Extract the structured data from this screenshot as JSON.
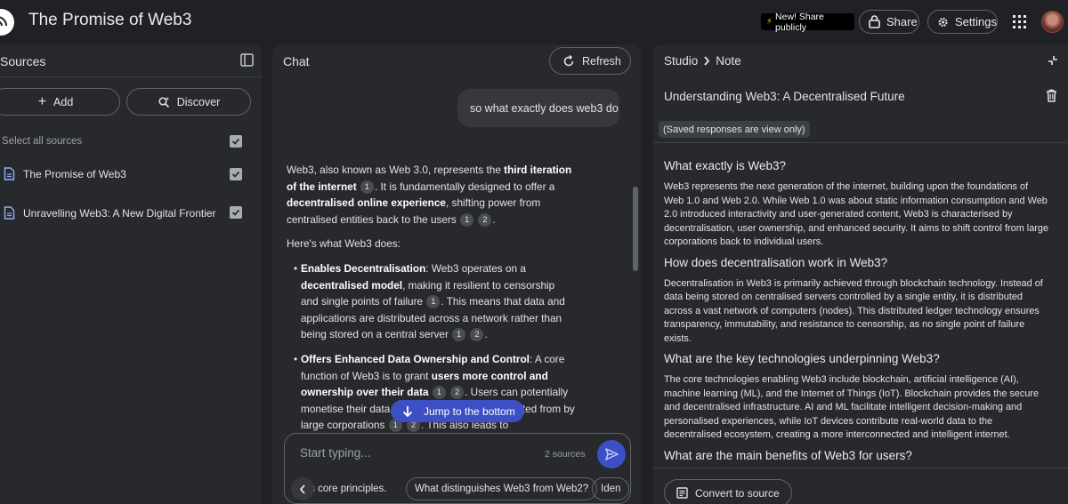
{
  "header": {
    "title": "The Promise of Web3",
    "share_publicly": "New! Share publicly",
    "share_label": "Share",
    "settings_label": "Settings"
  },
  "sources": {
    "title": "Sources",
    "add_label": "Add",
    "discover_label": "Discover",
    "select_all_label": "Select all sources",
    "items": [
      {
        "label": "The Promise of Web3",
        "checked": true
      },
      {
        "label": "Unravelling Web3: A New Digital Frontier",
        "checked": true
      }
    ]
  },
  "chat": {
    "title": "Chat",
    "refresh_label": "Refresh",
    "user_message": "so what exactly does web3 do",
    "answer": {
      "intro": {
        "t1": "Web3, also known as Web 3.0, represents the ",
        "b1": "third iteration of the internet",
        "t2": ". It is fundamentally designed to offer a ",
        "b2": "decentralised online experience",
        "t3": ", shifting power from centralised entities back to the users",
        "t4": "."
      },
      "lead": "Here's what Web3 does:",
      "bullet1": {
        "b1": "Enables Decentralisation",
        "t1": ": Web3 operates on a ",
        "b2": "decentralised model",
        "t2": ", making it resilient to censorship and single points of failure",
        "t3": ". This means that data and applications are distributed across a network rather than being stored on a central server",
        "t4": "."
      },
      "bullet2": {
        "b1": "Offers Enhanced Data Ownership and Control",
        "t1": ": A core function of Web3 is to grant ",
        "b2": "users more control and ownership over their data",
        "t2": ". Users can potentially monetise their data, ",
        "t3": "and profited from by large corporations",
        "t4": ". This also leads to"
      }
    },
    "jump_label": "Jump to the bottom",
    "composer_placeholder": "Start typing...",
    "source_count": "2 sources",
    "suggestions": [
      "'s core principles.",
      "What distinguishes Web3 from Web2?",
      "Iden"
    ]
  },
  "studio": {
    "crumb_root": "Studio",
    "crumb_leaf": "Note",
    "note_title": "Understanding Web3: A Decentralised Future",
    "view_only": "(Saved responses are view only)",
    "sections": [
      {
        "q": "What exactly is Web3?",
        "a": "Web3 represents the next generation of the internet, building upon the foundations of Web 1.0 and Web 2.0. While Web 1.0 was about static information consumption and Web 2.0 introduced interactivity and user-generated content, Web3 is characterised by decentralisation, user ownership, and enhanced security. It aims to shift control from large corporations back to individual users."
      },
      {
        "q": "How does decentralisation work in Web3?",
        "a": "Decentralisation in Web3 is primarily achieved through blockchain technology. Instead of data being stored on centralised servers controlled by a single entity, it is distributed across a vast network of computers (nodes). This distributed ledger technology ensures transparency, immutability, and resistance to censorship, as no single point of failure exists."
      },
      {
        "q": "What are the key technologies underpinning Web3?",
        "a": "The core technologies enabling Web3 include blockchain, artificial intelligence (AI), machine learning (ML), and the Internet of Things (IoT). Blockchain provides the secure and decentralised infrastructure. AI and ML facilitate intelligent decision-making and personalised experiences, while IoT devices contribute real-world data to the decentralised ecosystem, creating a more interconnected and intelligent internet."
      },
      {
        "q": "What are the main benefits of Web3 for users?",
        "a": ""
      }
    ],
    "convert_label": "Convert to source"
  }
}
